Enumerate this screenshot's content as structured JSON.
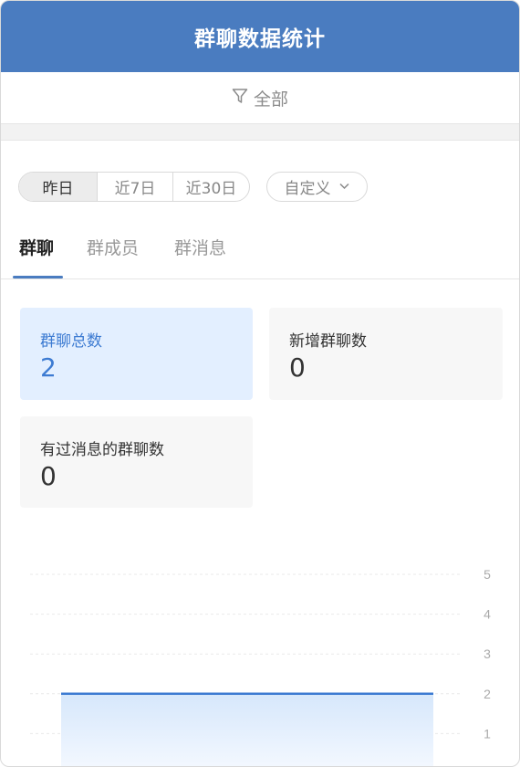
{
  "header": {
    "title": "群聊数据统计"
  },
  "filter": {
    "label": "全部",
    "icon": "funnel-icon"
  },
  "date_range": {
    "options": [
      "昨日",
      "近7日",
      "近30日"
    ],
    "selected": "昨日",
    "custom_label": "自定义"
  },
  "tabs": [
    "群聊",
    "群成员",
    "群消息"
  ],
  "active_tab": "群聊",
  "stats": [
    {
      "label": "群聊总数",
      "value": "2"
    },
    {
      "label": "新增群聊数",
      "value": "0"
    },
    {
      "label": "有过消息的群聊数",
      "value": "0"
    }
  ],
  "colors": {
    "header": "#4a7cc0",
    "accent": "#3d7bd2",
    "highlight_card": "#e3efff",
    "card": "#f7f7f7"
  },
  "chart_data": {
    "type": "area",
    "series": [
      {
        "values": [
          2,
          2
        ]
      }
    ],
    "ylim": [
      0,
      5
    ],
    "yticks": [
      "5",
      "4",
      "3",
      "2",
      "1"
    ],
    "grid": true
  }
}
